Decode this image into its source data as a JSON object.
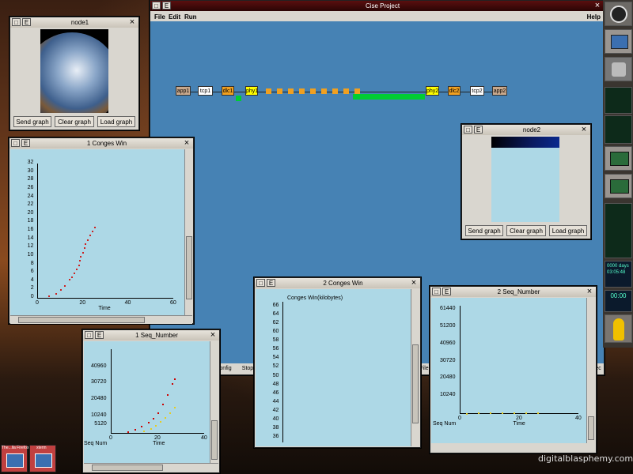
{
  "desktop": {
    "watermark": "digitalblasphemy.com",
    "taskbar": [
      {
        "label": "The...lla Firefox"
      },
      {
        "label": "xterm"
      }
    ]
  },
  "main": {
    "title": "Cise Project",
    "menu": {
      "file": "File",
      "edit": "Edit",
      "run": "Run",
      "help": "Help"
    },
    "btn_e": "E",
    "close": "×",
    "bottom_peek": {
      "config": "onfig",
      "stop": "Stop",
      "file": "File",
      "exec": "ec"
    },
    "chain": [
      "app1",
      "tcp1",
      "dlc1",
      "phy1",
      "phy2",
      "dlc2",
      "tcp2",
      "app2"
    ]
  },
  "node1": {
    "title": "node1",
    "btn_e": "E",
    "close": "×",
    "send": "Send graph",
    "clear": "Clear graph",
    "load": "Load  graph"
  },
  "node2": {
    "title": "node2",
    "btn_e": "E",
    "close": "×",
    "send": "Send graph",
    "clear": "Clear graph",
    "load": "Load  graph"
  },
  "cw1": {
    "title": "1 Conges Win",
    "btn_e": "E",
    "close": "×",
    "chart_data": {
      "type": "scatter",
      "xlabel": "Time",
      "ylabel": "",
      "xticks": [
        "0",
        "20",
        "40",
        "60"
      ],
      "yticks": [
        "0",
        "2",
        "4",
        "6",
        "8",
        "10",
        "12",
        "14",
        "16",
        "18",
        "20",
        "22",
        "24",
        "26",
        "28",
        "30",
        "32"
      ],
      "xlim": [
        0,
        60
      ],
      "ylim": [
        0,
        32
      ],
      "series": [
        {
          "color": "#cc2222",
          "points": [
            [
              5,
              0.5
            ],
            [
              8,
              1.2
            ],
            [
              10,
              2
            ],
            [
              12,
              3
            ],
            [
              14,
              4.5
            ],
            [
              15,
              5
            ],
            [
              16,
              6
            ],
            [
              17,
              7
            ],
            [
              18,
              8
            ],
            [
              18.5,
              9
            ],
            [
              19,
              10
            ],
            [
              20,
              11
            ],
            [
              20.5,
              12
            ],
            [
              21,
              13
            ],
            [
              22,
              14
            ],
            [
              23,
              15
            ],
            [
              24,
              16
            ],
            [
              25,
              17
            ]
          ]
        }
      ]
    }
  },
  "sn1": {
    "title": "1 Seq_Number",
    "btn_e": "E",
    "close": "×",
    "chart_data": {
      "type": "scatter",
      "xlabel": "Time",
      "ylabel": "Seq Num",
      "xticks": [
        "0",
        "20",
        "40"
      ],
      "yticks": [
        "10240",
        "20480",
        "30720",
        "40960",
        "5120"
      ],
      "xlim": [
        0,
        40
      ],
      "ylim": [
        0,
        52000
      ],
      "series": [
        {
          "name": "",
          "color": "#cc0000",
          "points": [
            [
              7,
              1000
            ],
            [
              10,
              2500
            ],
            [
              13,
              4500
            ],
            [
              16,
              7000
            ],
            [
              18,
              9500
            ],
            [
              20,
              13000
            ],
            [
              22,
              18000
            ],
            [
              24,
              24000
            ],
            [
              26,
              31000
            ],
            [
              27,
              34000
            ]
          ]
        },
        {
          "name": "",
          "color": "#e6cc22",
          "points": [
            [
              14,
              1500
            ],
            [
              17,
              3000
            ],
            [
              19,
              5000
            ],
            [
              21,
              7500
            ],
            [
              23,
              10000
            ],
            [
              25,
              13000
            ],
            [
              27,
              16000
            ]
          ]
        }
      ]
    }
  },
  "cw2": {
    "title": "2 Conges Win",
    "btn_e": "E",
    "close": "×",
    "legend": "Conges Win(kilobytes)",
    "chart_data": {
      "type": "scatter",
      "xlabel": "",
      "ylabel": "",
      "yticks": [
        "36",
        "38",
        "40",
        "42",
        "44",
        "46",
        "48",
        "50",
        "52",
        "54",
        "56",
        "58",
        "60",
        "62",
        "64",
        "66"
      ],
      "ylim": [
        35,
        67
      ],
      "series": []
    }
  },
  "sn2": {
    "title": "2 Seq_Number",
    "btn_e": "E",
    "close": "×",
    "chart_data": {
      "type": "scatter",
      "xlabel": "Time",
      "ylabel": "Seq Num",
      "xticks": [
        "0",
        "20",
        "40"
      ],
      "yticks": [
        "10240",
        "20480",
        "30720",
        "40960",
        "51200",
        "61440"
      ],
      "xlim": [
        0,
        40
      ],
      "ylim": [
        0,
        64000
      ],
      "series": [
        {
          "color": "#e6cc22",
          "points": [
            [
              2,
              200
            ],
            [
              6,
              250
            ],
            [
              10,
              300
            ],
            [
              14,
              350
            ],
            [
              18,
              400
            ],
            [
              22,
              450
            ],
            [
              26,
              500
            ]
          ]
        }
      ]
    }
  },
  "dock": {
    "clock": "0000 days 03:05:48",
    "time2": "00:00"
  }
}
